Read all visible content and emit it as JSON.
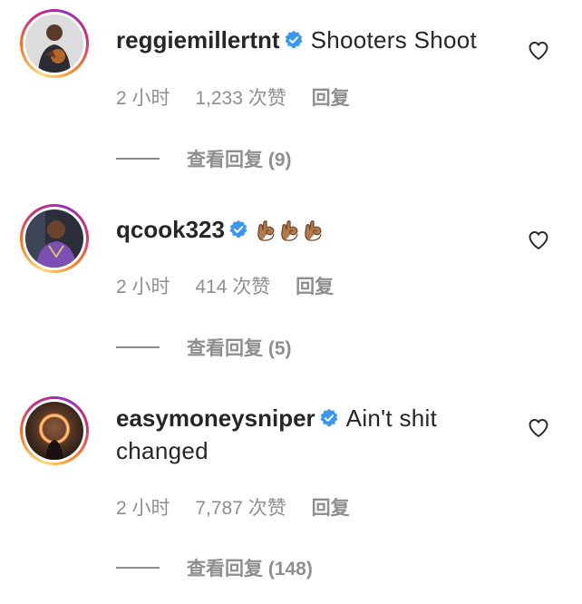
{
  "comments": [
    {
      "username": "reggiemillertnt",
      "text": "Shooters Shoot",
      "time": "2 小时",
      "likes": "1,233 次赞",
      "reply_label": "回复",
      "view_replies": "查看回复 (9)"
    },
    {
      "username": "qcook323",
      "text": "",
      "emoji_count": 3,
      "emoji_name": "ok-hand-emoji",
      "time": "2 小时",
      "likes": "414 次赞",
      "reply_label": "回复",
      "view_replies": "查看回复 (5)"
    },
    {
      "username": "easymoneysniper",
      "text": "Ain't shit changed",
      "time": "2 小时",
      "likes": "7,787 次赞",
      "reply_label": "回复",
      "view_replies": "查看回复 (148)"
    }
  ],
  "colors": {
    "text": "#262626",
    "secondary": "#8e8e8e",
    "verified": "#3897f0"
  },
  "icons": {
    "verified": "verified-badge-icon",
    "like": "heart-outline-icon"
  }
}
